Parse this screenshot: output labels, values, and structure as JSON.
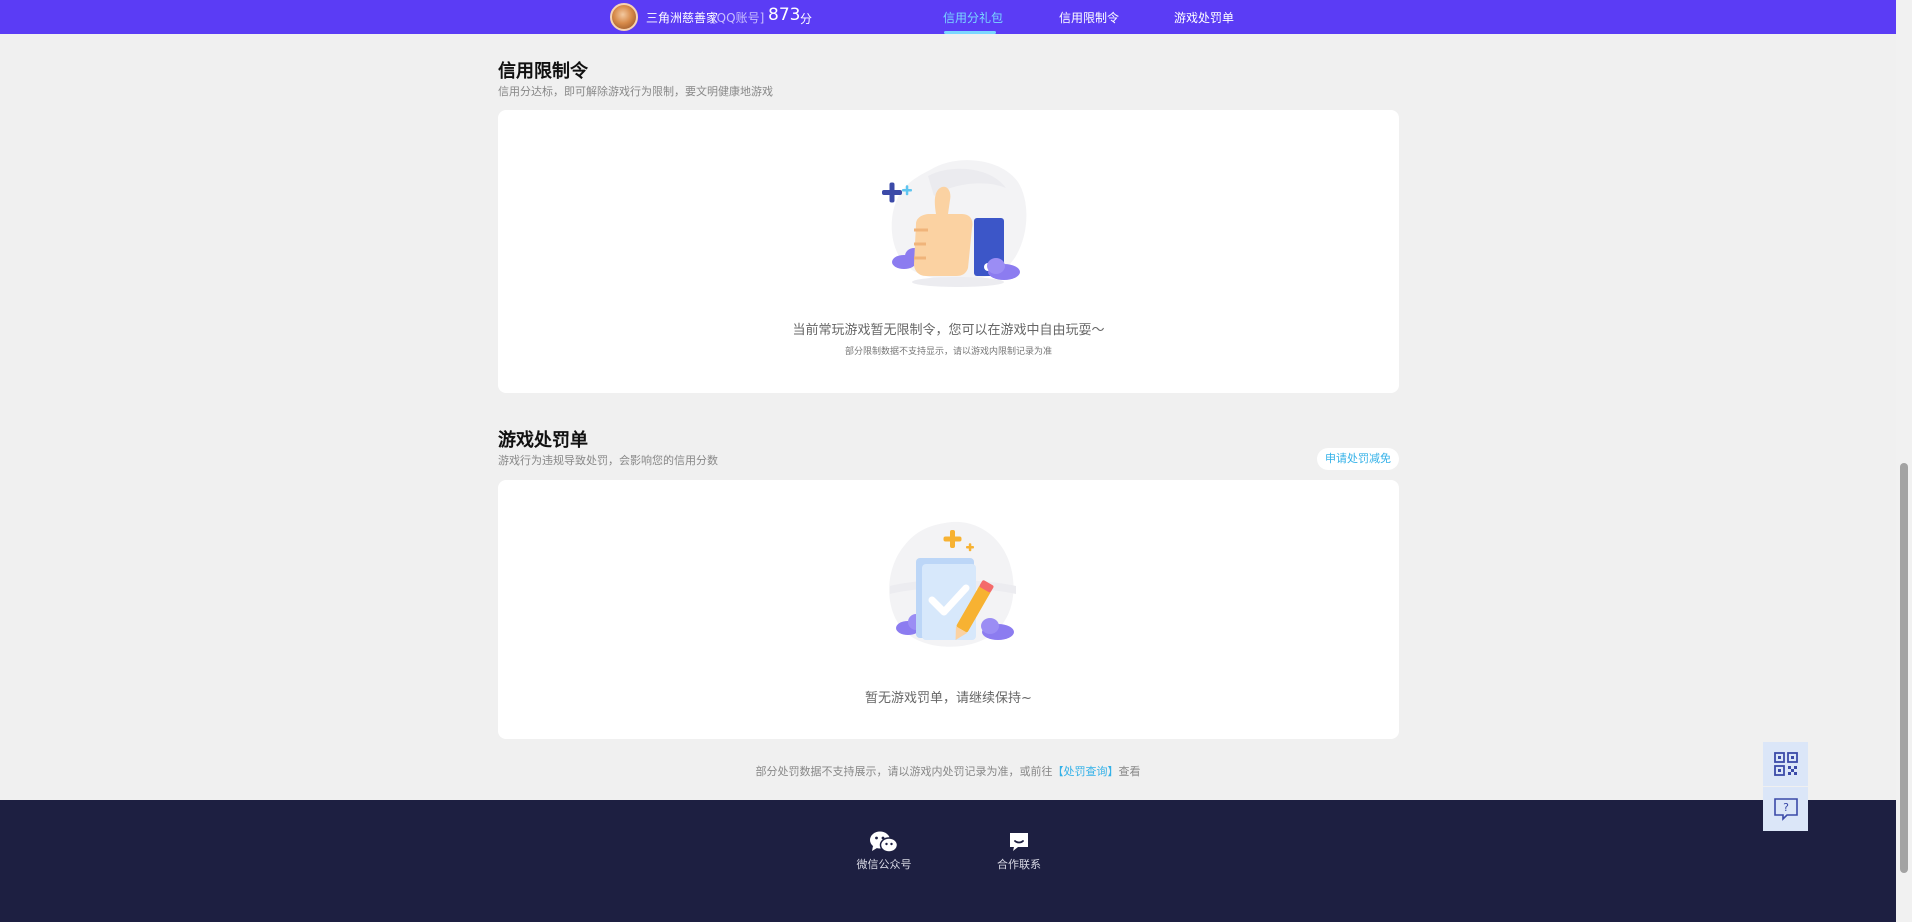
{
  "header": {
    "username": "三角洲慈善家",
    "account_type": "[QQ账号]",
    "score": "873",
    "score_unit": "分",
    "tabs": [
      {
        "label": "信用分礼包",
        "active": true
      },
      {
        "label": "信用限制令",
        "active": false
      },
      {
        "label": "游戏处罚单",
        "active": false
      }
    ]
  },
  "restriction": {
    "title": "信用限制令",
    "subtitle": "信用分达标，即可解除游戏行为限制，要文明健康地游戏",
    "empty_text": "当前常玩游戏暂无限制令，您可以在游戏中自由玩耍～",
    "empty_note": "部分限制数据不支持显示，请以游戏内限制记录为准",
    "illustration_icon": "thumbs-up-icon"
  },
  "penalty": {
    "title": "游戏处罚单",
    "subtitle": "游戏行为违规导致处罚，会影响您的信用分数",
    "apply_button": "申请处罚减免",
    "empty_text": "暂无游戏罚单，请继续保持~",
    "illustration_icon": "checked-notebook-icon"
  },
  "bottom_note": {
    "prefix": "部分处罚数据不支持展示，请以游戏内处罚记录为准，或前往",
    "link": "【处罚查询】",
    "suffix": "查看"
  },
  "footer": {
    "items": [
      {
        "label": "微信公众号",
        "icon": "wechat-icon"
      },
      {
        "label": "合作联系",
        "icon": "chat-bubble-icon"
      }
    ]
  },
  "side_widgets": [
    "qr-code-icon",
    "help-question-icon"
  ],
  "colors": {
    "header_bg": "#5b3cf5",
    "active_tab": "#7ad7ff",
    "link": "#33b1e8",
    "footer_bg": "#1d1f41",
    "page_bg": "#f0f0f0"
  }
}
